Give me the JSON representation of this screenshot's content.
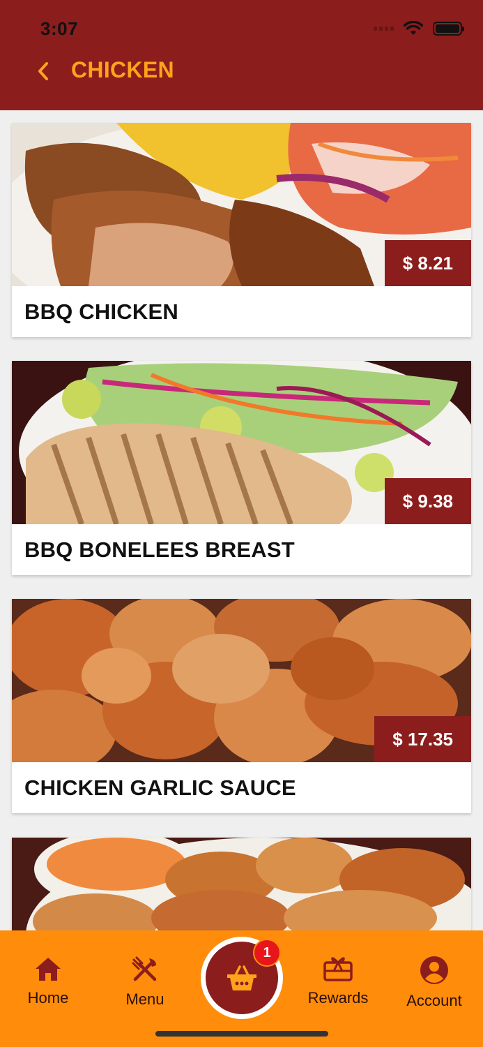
{
  "status_bar": {
    "time": "3:07"
  },
  "header": {
    "title": "CHICKEN",
    "back_icon": "chevron-left-icon"
  },
  "items": [
    {
      "name": "BBQ CHICKEN",
      "price": "$ 8.21"
    },
    {
      "name": "BBQ BONELEES BREAST",
      "price": "$ 9.38"
    },
    {
      "name": "CHICKEN GARLIC SAUCE",
      "price": "$ 17.35"
    },
    {
      "name": "",
      "price": ""
    }
  ],
  "tabbar": {
    "home": "Home",
    "menu": "Menu",
    "cart_count": "1",
    "rewards": "Rewards",
    "account": "Account"
  },
  "colors": {
    "brand": "#8c1d1d",
    "accent": "#ffa21c",
    "tabbar": "#ff8c0a",
    "badge": "#e8151b"
  }
}
